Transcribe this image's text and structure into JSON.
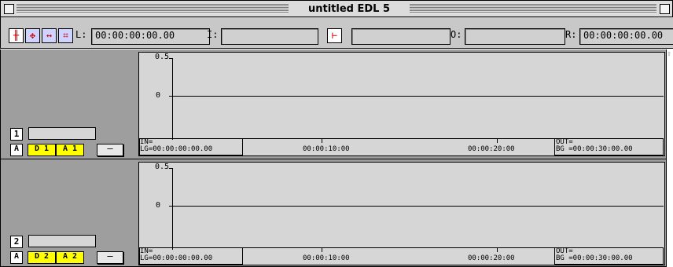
{
  "window": {
    "title": "untitled EDL 5"
  },
  "toolbar": {
    "tools": [
      {
        "icon": "split-tool-icon"
      },
      {
        "icon": "move-tool-icon"
      },
      {
        "icon": "stretch-tool-icon"
      },
      {
        "icon": "grid-tool-icon"
      },
      {
        "icon": "marker-tool-icon"
      }
    ],
    "L_label": "L:",
    "L_value": "00:00:00:00.00",
    "I_label": "I:",
    "I_value": "",
    "unnamed_value": "",
    "O_label": "O:",
    "O_value": "",
    "R_label": "R:",
    "R_value": "00:00:00:00.00"
  },
  "tracks": [
    {
      "number": "1",
      "name": "",
      "chip_a": "A",
      "chip_d": "D 1",
      "chip_a2": "A 1",
      "minus": "—",
      "y_top": "0.5",
      "y_mid": "0",
      "in_label": "IN=",
      "in_value": "LG=00:00:00:00.00",
      "t1": "00:00:10:00",
      "t2": "00:00:20:00",
      "out_label": "OUT=",
      "out_value": "BG =00:00:30:00.00"
    },
    {
      "number": "2",
      "name": "",
      "chip_a": "A",
      "chip_d": "D 2",
      "chip_a2": "A 2",
      "minus": "—",
      "y_top": "0.5",
      "y_mid": "0",
      "in_label": "IN=",
      "in_value": "LG=00:00:00:00.00",
      "t1": "00:00:10:00",
      "t2": "00:00:20:00",
      "out_label": "OUT=",
      "out_value": "BG =00:00:30:00.00"
    }
  ]
}
